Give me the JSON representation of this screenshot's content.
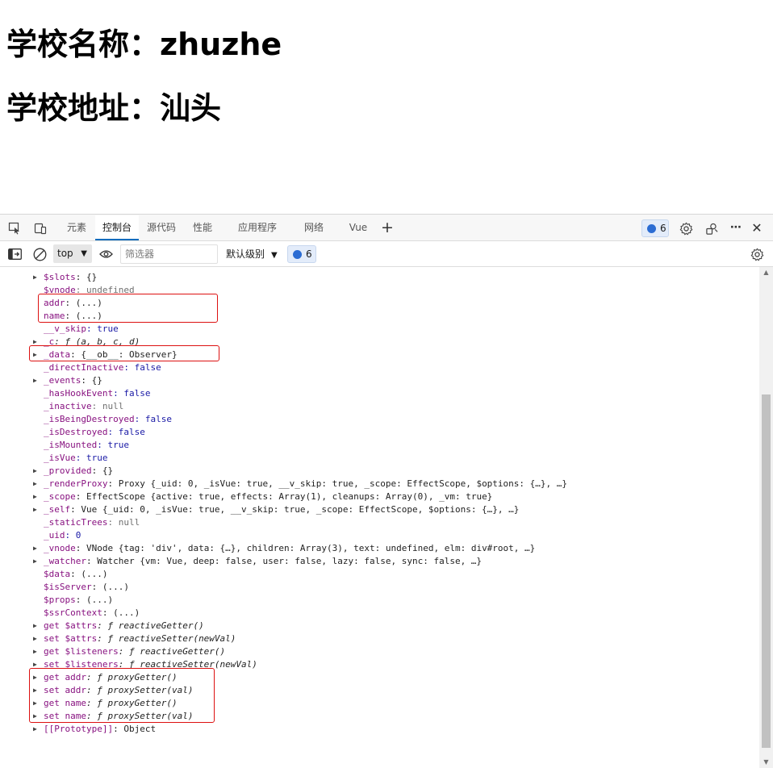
{
  "page": {
    "school_name_heading": "学校名称：zhuzhe",
    "school_addr_heading": "学校地址：汕头"
  },
  "devtools": {
    "tabs": [
      {
        "label": "元素",
        "active": false
      },
      {
        "label": "控制台",
        "active": true
      },
      {
        "label": "源代码",
        "active": false
      },
      {
        "label": "性能",
        "active": false
      },
      {
        "label": "应用程序",
        "active": false
      },
      {
        "label": "网络",
        "active": false
      },
      {
        "label": "Vue",
        "active": false
      }
    ],
    "add_tab_label": "+",
    "issues_count": "6",
    "more_label": "⋯",
    "close_label": "✕",
    "console_toolbar": {
      "context": "top",
      "filter_placeholder": "筛选器",
      "level_label": "默认级别",
      "issues_count": "6"
    },
    "prompt_glyph": "›"
  },
  "console_rows": [
    {
      "caret": true,
      "key": "$slots",
      "rest": ": {}"
    },
    {
      "caret": false,
      "key": "$vnode",
      "rest": ": undefined"
    },
    {
      "caret": false,
      "key": "addr",
      "rest": ": (...)"
    },
    {
      "caret": false,
      "key": "name",
      "rest": ": (...)"
    },
    {
      "caret": false,
      "key": "__v_skip",
      "rest": ": true"
    },
    {
      "caret": true,
      "key": "_c",
      "rest": ": ƒ (a, b, c, d)"
    },
    {
      "caret": true,
      "key": "_data",
      "rest": ": {__ob__: Observer}"
    },
    {
      "caret": false,
      "key": "_directInactive",
      "rest": ": false"
    },
    {
      "caret": true,
      "key": "_events",
      "rest": ": {}"
    },
    {
      "caret": false,
      "key": "_hasHookEvent",
      "rest": ": false"
    },
    {
      "caret": false,
      "key": "_inactive",
      "rest": ": null"
    },
    {
      "caret": false,
      "key": "_isBeingDestroyed",
      "rest": ": false"
    },
    {
      "caret": false,
      "key": "_isDestroyed",
      "rest": ": false"
    },
    {
      "caret": false,
      "key": "_isMounted",
      "rest": ": true"
    },
    {
      "caret": false,
      "key": "_isVue",
      "rest": ": true"
    },
    {
      "caret": true,
      "key": "_provided",
      "rest": ": {}"
    },
    {
      "caret": true,
      "key": "_renderProxy",
      "rest": ": Proxy {_uid: 0, _isVue: true, __v_skip: true, _scope: EffectScope, $options: {…}, …}"
    },
    {
      "caret": true,
      "key": "_scope",
      "rest": ": EffectScope {active: true, effects: Array(1), cleanups: Array(0), _vm: true}"
    },
    {
      "caret": true,
      "key": "_self",
      "rest": ": Vue {_uid: 0, _isVue: true, __v_skip: true, _scope: EffectScope, $options: {…}, …}"
    },
    {
      "caret": false,
      "key": "_staticTrees",
      "rest": ": null"
    },
    {
      "caret": false,
      "key": "_uid",
      "rest": ": 0"
    },
    {
      "caret": true,
      "key": "_vnode",
      "rest": ": VNode {tag: 'div', data: {…}, children: Array(3), text: undefined, elm: div#root, …}"
    },
    {
      "caret": true,
      "key": "_watcher",
      "rest": ": Watcher {vm: Vue, deep: false, user: false, lazy: false, sync: false, …}"
    },
    {
      "caret": false,
      "key": "$data",
      "rest": ": (...)"
    },
    {
      "caret": false,
      "key": "$isServer",
      "rest": ": (...)"
    },
    {
      "caret": false,
      "key": "$props",
      "rest": ": (...)"
    },
    {
      "caret": false,
      "key": "$ssrContext",
      "rest": ": (...)"
    },
    {
      "caret": true,
      "key": "get $attrs",
      "rest": ": ƒ reactiveGetter()"
    },
    {
      "caret": true,
      "key": "set $attrs",
      "rest": ": ƒ reactiveSetter(newVal)"
    },
    {
      "caret": true,
      "key": "get $listeners",
      "rest": ": ƒ reactiveGetter()"
    },
    {
      "caret": true,
      "key": "set $listeners",
      "rest": ": ƒ reactiveSetter(newVal)"
    },
    {
      "caret": true,
      "key": "get addr",
      "rest": ": ƒ proxyGetter()"
    },
    {
      "caret": true,
      "key": "set addr",
      "rest": ": ƒ proxySetter(val)"
    },
    {
      "caret": true,
      "key": "get name",
      "rest": ": ƒ proxyGetter()"
    },
    {
      "caret": true,
      "key": "set name",
      "rest": ": ƒ proxySetter(val)"
    },
    {
      "caret": true,
      "key": "[[Prototype]]",
      "rest": ": Object"
    }
  ],
  "highlight_color": "#dd1111"
}
